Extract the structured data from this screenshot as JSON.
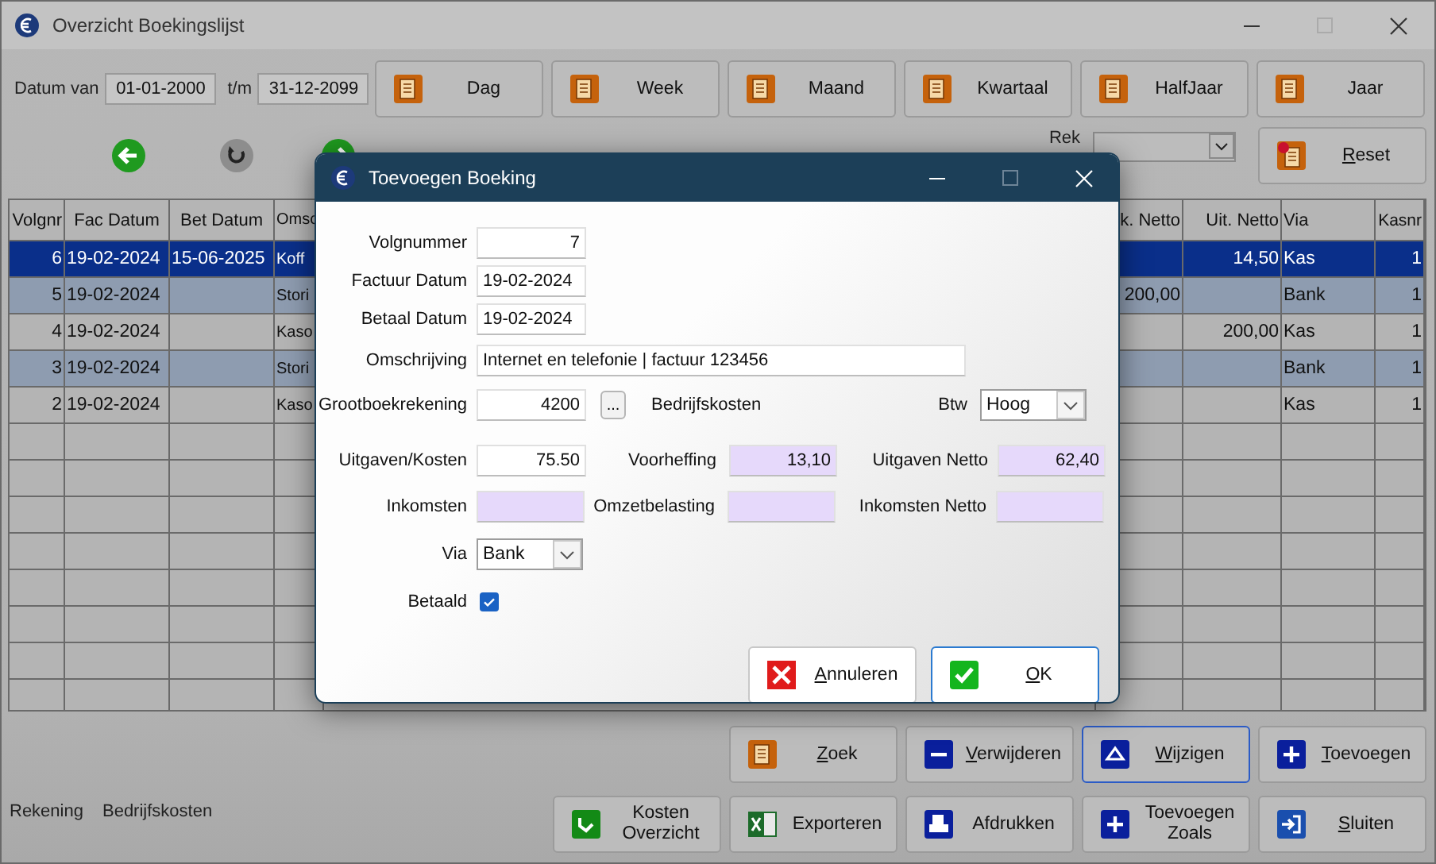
{
  "window": {
    "title": "Overzicht Boekingslijst"
  },
  "date_filter": {
    "from_label": "Datum van",
    "from": "01-01-2000",
    "to_label": "t/m",
    "to": "31-12-2099"
  },
  "period_buttons": [
    {
      "label": "Dag",
      "kind": "doc"
    },
    {
      "label": "Week",
      "kind": "doc"
    },
    {
      "label": "Maand",
      "kind": "doc"
    },
    {
      "label": "Kwartaal",
      "kind": "doc"
    },
    {
      "label": "HalfJaar",
      "kind": "doc"
    },
    {
      "label": "Jaar",
      "kind": "doc"
    }
  ],
  "navigation": [
    {
      "kind": "back"
    },
    {
      "kind": "refresh"
    },
    {
      "kind": "forward"
    }
  ],
  "account_filter": {
    "label": "Rek"
  },
  "reset_button": {
    "label": "Reset",
    "kind": "reset",
    "mnemonic": true
  },
  "table": {
    "columns": [
      "Volgnr",
      "Fac Datum",
      "Bet Datum",
      "Omsc",
      "k. Netto",
      "Uit. Netto",
      "Via",
      "Kasnr"
    ],
    "rows": [
      {
        "selected": true,
        "cells": [
          "6",
          "19-02-2024",
          "15-06-2025",
          "Koff",
          null,
          "14,50",
          "Kas",
          "1"
        ]
      },
      {
        "selected": false,
        "cells": [
          "5",
          "19-02-2024",
          null,
          "Stori",
          "200,00",
          null,
          "Bank",
          "1"
        ]
      },
      {
        "selected": false,
        "cells": [
          "4",
          "19-02-2024",
          null,
          "Kaso",
          null,
          "200,00",
          "Kas",
          "1"
        ]
      },
      {
        "selected": false,
        "cells": [
          "3",
          "19-02-2024",
          null,
          "Stori",
          null,
          null,
          "Bank",
          "1"
        ]
      },
      {
        "selected": false,
        "cells": [
          "2",
          "19-02-2024",
          null,
          "Kaso",
          null,
          null,
          "Kas",
          "1"
        ]
      }
    ]
  },
  "status_bar": {
    "label": "Rekening",
    "value": "Bedrijfskosten"
  },
  "action_buttons": [
    [
      {
        "label": "Zoek",
        "kind": "doc",
        "mnemonic": true,
        "focused": false
      },
      {
        "label": "Verwijderen",
        "kind": "minus",
        "mnemonic": true,
        "focused": false
      },
      {
        "label": "Wijzigen",
        "kind": "eject",
        "mnemonic": true,
        "focused": true
      },
      {
        "label": "Toevoegen",
        "kind": "plus",
        "mnemonic": true,
        "focused": false
      }
    ],
    [
      {
        "label": "Kosten Overzicht",
        "kind": "refresh",
        "mnemonic": false,
        "focused": false
      },
      {
        "label": "Exporteren",
        "kind": "excel",
        "mnemonic": false,
        "focused": false
      },
      {
        "label": "Afdrukken",
        "kind": "print",
        "mnemonic": false,
        "focused": false
      },
      {
        "label": "Toevoegen Zoals",
        "kind": "plus",
        "mnemonic": false,
        "focused": false
      },
      {
        "label": "Sluiten",
        "kind": "enter",
        "mnemonic": true,
        "focused": false
      }
    ]
  ],
  "dialog": {
    "title": "Toevoegen Boeking",
    "rows": [
      [
        {
          "kind": "label",
          "text": "Volgnummer"
        },
        {
          "kind": "number",
          "value": "7"
        }
      ],
      [
        {
          "kind": "label",
          "text": "Factuur Datum"
        },
        {
          "kind": "date",
          "value": "19-02-2024"
        }
      ],
      [
        {
          "kind": "label",
          "text": "Betaal Datum"
        },
        {
          "kind": "date",
          "value": "19-02-2024"
        }
      ],
      [
        {
          "kind": "label",
          "text": "Omschrijving"
        },
        {
          "kind": "textline",
          "value": "Internet en telefonie | factuur 123456"
        }
      ],
      [
        {
          "kind": "label",
          "text": "Grootboekrekening"
        },
        {
          "kind": "number",
          "value": "4200"
        },
        {
          "kind": "lookup",
          "text": "..."
        },
        {
          "kind": "note",
          "text": "Bedrijfskosten"
        },
        {
          "kind": "label",
          "text": "Btw"
        },
        {
          "kind": "select",
          "value": "Hoog"
        }
      ],
      [
        {
          "kind": "label",
          "text": "Uitgaven/Kosten"
        },
        {
          "kind": "number",
          "value": "75.50"
        },
        {
          "kind": "label",
          "text": "Voorheffing"
        },
        {
          "kind": "computed",
          "value": "13,10"
        },
        {
          "kind": "label",
          "text": "Uitgaven Netto"
        },
        {
          "kind": "computed",
          "value": "62,40"
        }
      ],
      [
        {
          "kind": "label",
          "text": "Inkomsten"
        },
        {
          "kind": "computed"
        },
        {
          "kind": "label",
          "text": "Omzetbelasting"
        },
        {
          "kind": "computed"
        },
        {
          "kind": "label",
          "text": "Inkomsten Netto"
        },
        {
          "kind": "computed"
        }
      ],
      [
        {
          "kind": "label",
          "text": "Via"
        },
        {
          "kind": "select",
          "value": "Bank"
        }
      ],
      [
        {
          "kind": "label",
          "text": "Betaald"
        },
        {
          "kind": "checkbox",
          "checked": true
        }
      ]
    ],
    "buttons": [
      {
        "label": "Annuleren",
        "kind": "cancel",
        "mnemonic": true,
        "focused": false
      },
      {
        "label": "OK",
        "kind": "ok",
        "mnemonic": true,
        "focused": true
      }
    ]
  }
}
